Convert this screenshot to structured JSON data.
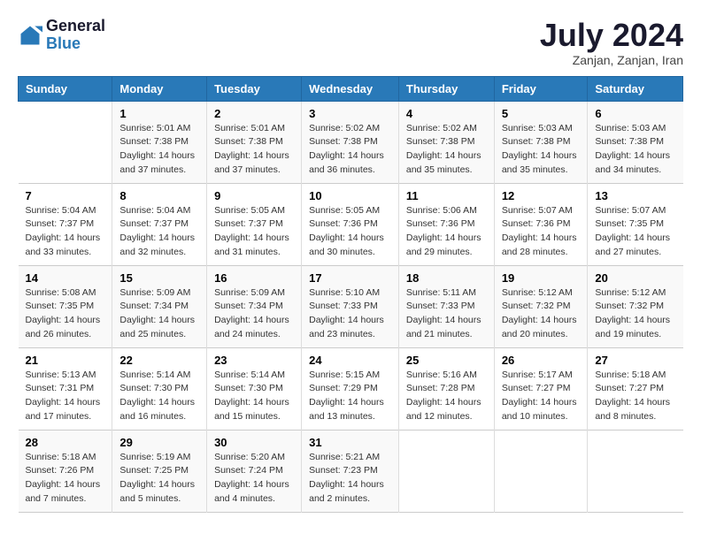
{
  "header": {
    "logo_line1": "General",
    "logo_line2": "Blue",
    "month_title": "July 2024",
    "subtitle": "Zanjan, Zanjan, Iran"
  },
  "weekdays": [
    "Sunday",
    "Monday",
    "Tuesday",
    "Wednesday",
    "Thursday",
    "Friday",
    "Saturday"
  ],
  "weeks": [
    [
      {
        "day": "",
        "sunrise": "",
        "sunset": "",
        "daylight": ""
      },
      {
        "day": "1",
        "sunrise": "Sunrise: 5:01 AM",
        "sunset": "Sunset: 7:38 PM",
        "daylight": "Daylight: 14 hours and 37 minutes."
      },
      {
        "day": "2",
        "sunrise": "Sunrise: 5:01 AM",
        "sunset": "Sunset: 7:38 PM",
        "daylight": "Daylight: 14 hours and 37 minutes."
      },
      {
        "day": "3",
        "sunrise": "Sunrise: 5:02 AM",
        "sunset": "Sunset: 7:38 PM",
        "daylight": "Daylight: 14 hours and 36 minutes."
      },
      {
        "day": "4",
        "sunrise": "Sunrise: 5:02 AM",
        "sunset": "Sunset: 7:38 PM",
        "daylight": "Daylight: 14 hours and 35 minutes."
      },
      {
        "day": "5",
        "sunrise": "Sunrise: 5:03 AM",
        "sunset": "Sunset: 7:38 PM",
        "daylight": "Daylight: 14 hours and 35 minutes."
      },
      {
        "day": "6",
        "sunrise": "Sunrise: 5:03 AM",
        "sunset": "Sunset: 7:38 PM",
        "daylight": "Daylight: 14 hours and 34 minutes."
      }
    ],
    [
      {
        "day": "7",
        "sunrise": "Sunrise: 5:04 AM",
        "sunset": "Sunset: 7:37 PM",
        "daylight": "Daylight: 14 hours and 33 minutes."
      },
      {
        "day": "8",
        "sunrise": "Sunrise: 5:04 AM",
        "sunset": "Sunset: 7:37 PM",
        "daylight": "Daylight: 14 hours and 32 minutes."
      },
      {
        "day": "9",
        "sunrise": "Sunrise: 5:05 AM",
        "sunset": "Sunset: 7:37 PM",
        "daylight": "Daylight: 14 hours and 31 minutes."
      },
      {
        "day": "10",
        "sunrise": "Sunrise: 5:05 AM",
        "sunset": "Sunset: 7:36 PM",
        "daylight": "Daylight: 14 hours and 30 minutes."
      },
      {
        "day": "11",
        "sunrise": "Sunrise: 5:06 AM",
        "sunset": "Sunset: 7:36 PM",
        "daylight": "Daylight: 14 hours and 29 minutes."
      },
      {
        "day": "12",
        "sunrise": "Sunrise: 5:07 AM",
        "sunset": "Sunset: 7:36 PM",
        "daylight": "Daylight: 14 hours and 28 minutes."
      },
      {
        "day": "13",
        "sunrise": "Sunrise: 5:07 AM",
        "sunset": "Sunset: 7:35 PM",
        "daylight": "Daylight: 14 hours and 27 minutes."
      }
    ],
    [
      {
        "day": "14",
        "sunrise": "Sunrise: 5:08 AM",
        "sunset": "Sunset: 7:35 PM",
        "daylight": "Daylight: 14 hours and 26 minutes."
      },
      {
        "day": "15",
        "sunrise": "Sunrise: 5:09 AM",
        "sunset": "Sunset: 7:34 PM",
        "daylight": "Daylight: 14 hours and 25 minutes."
      },
      {
        "day": "16",
        "sunrise": "Sunrise: 5:09 AM",
        "sunset": "Sunset: 7:34 PM",
        "daylight": "Daylight: 14 hours and 24 minutes."
      },
      {
        "day": "17",
        "sunrise": "Sunrise: 5:10 AM",
        "sunset": "Sunset: 7:33 PM",
        "daylight": "Daylight: 14 hours and 23 minutes."
      },
      {
        "day": "18",
        "sunrise": "Sunrise: 5:11 AM",
        "sunset": "Sunset: 7:33 PM",
        "daylight": "Daylight: 14 hours and 21 minutes."
      },
      {
        "day": "19",
        "sunrise": "Sunrise: 5:12 AM",
        "sunset": "Sunset: 7:32 PM",
        "daylight": "Daylight: 14 hours and 20 minutes."
      },
      {
        "day": "20",
        "sunrise": "Sunrise: 5:12 AM",
        "sunset": "Sunset: 7:32 PM",
        "daylight": "Daylight: 14 hours and 19 minutes."
      }
    ],
    [
      {
        "day": "21",
        "sunrise": "Sunrise: 5:13 AM",
        "sunset": "Sunset: 7:31 PM",
        "daylight": "Daylight: 14 hours and 17 minutes."
      },
      {
        "day": "22",
        "sunrise": "Sunrise: 5:14 AM",
        "sunset": "Sunset: 7:30 PM",
        "daylight": "Daylight: 14 hours and 16 minutes."
      },
      {
        "day": "23",
        "sunrise": "Sunrise: 5:14 AM",
        "sunset": "Sunset: 7:30 PM",
        "daylight": "Daylight: 14 hours and 15 minutes."
      },
      {
        "day": "24",
        "sunrise": "Sunrise: 5:15 AM",
        "sunset": "Sunset: 7:29 PM",
        "daylight": "Daylight: 14 hours and 13 minutes."
      },
      {
        "day": "25",
        "sunrise": "Sunrise: 5:16 AM",
        "sunset": "Sunset: 7:28 PM",
        "daylight": "Daylight: 14 hours and 12 minutes."
      },
      {
        "day": "26",
        "sunrise": "Sunrise: 5:17 AM",
        "sunset": "Sunset: 7:27 PM",
        "daylight": "Daylight: 14 hours and 10 minutes."
      },
      {
        "day": "27",
        "sunrise": "Sunrise: 5:18 AM",
        "sunset": "Sunset: 7:27 PM",
        "daylight": "Daylight: 14 hours and 8 minutes."
      }
    ],
    [
      {
        "day": "28",
        "sunrise": "Sunrise: 5:18 AM",
        "sunset": "Sunset: 7:26 PM",
        "daylight": "Daylight: 14 hours and 7 minutes."
      },
      {
        "day": "29",
        "sunrise": "Sunrise: 5:19 AM",
        "sunset": "Sunset: 7:25 PM",
        "daylight": "Daylight: 14 hours and 5 minutes."
      },
      {
        "day": "30",
        "sunrise": "Sunrise: 5:20 AM",
        "sunset": "Sunset: 7:24 PM",
        "daylight": "Daylight: 14 hours and 4 minutes."
      },
      {
        "day": "31",
        "sunrise": "Sunrise: 5:21 AM",
        "sunset": "Sunset: 7:23 PM",
        "daylight": "Daylight: 14 hours and 2 minutes."
      },
      {
        "day": "",
        "sunrise": "",
        "sunset": "",
        "daylight": ""
      },
      {
        "day": "",
        "sunrise": "",
        "sunset": "",
        "daylight": ""
      },
      {
        "day": "",
        "sunrise": "",
        "sunset": "",
        "daylight": ""
      }
    ]
  ]
}
